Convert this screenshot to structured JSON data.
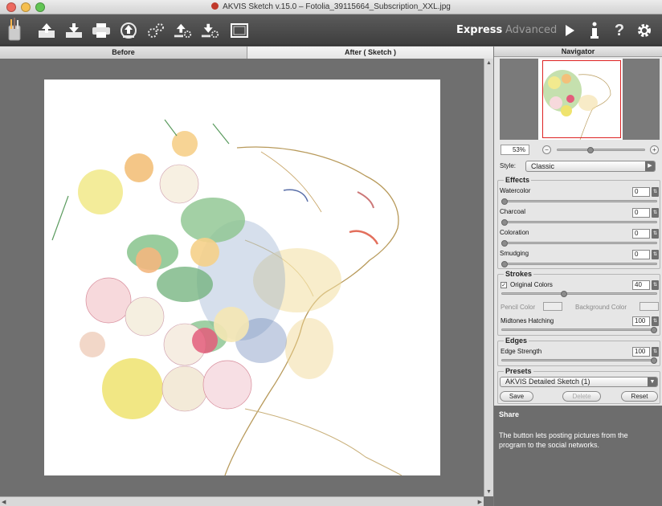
{
  "window": {
    "title": "AKVIS Sketch v.15.0 – Fotolia_39115664_Subscription_XXL.jpg",
    "traffic_lights": [
      "#ed6a5f",
      "#f5bf4f",
      "#62c554"
    ]
  },
  "toolbar": {
    "icons": [
      "sketch-tool-icon",
      "open-icon",
      "save-icon",
      "print-icon",
      "import-preset-icon",
      "batch-icon",
      "preferences-icon",
      "export-preset-icon",
      "crop-icon"
    ],
    "express_label": "Express",
    "advanced_label": "Advanced",
    "run_icon": "play-icon",
    "info_icon": "info-icon",
    "help_icon": "help-icon",
    "settings_icon": "gear-icon",
    "express_color": "#ffffff",
    "advanced_color": "#9c9c9c"
  },
  "tabs": {
    "before": "Before",
    "after": "After ( Sketch )"
  },
  "navigator": {
    "title": "Navigator",
    "zoom": "53%"
  },
  "style": {
    "label": "Style:",
    "value": "Classic"
  },
  "effects": {
    "title": "Effects",
    "items": [
      {
        "label": "Watercolor",
        "value": "0",
        "level": 0
      },
      {
        "label": "Charcoal",
        "value": "0",
        "level": 0
      },
      {
        "label": "Coloration",
        "value": "0",
        "level": 0
      },
      {
        "label": "Smudging",
        "value": "0",
        "level": 0
      }
    ]
  },
  "strokes": {
    "title": "Strokes",
    "original_colors_label": "Original Colors",
    "original_colors_checked": true,
    "stroke_value": "40",
    "stroke_level": 0.4,
    "pencil_color_label": "Pencil Color",
    "background_color_label": "Background Color",
    "midtones_label": "Midtones Hatching",
    "midtones_value": "100",
    "midtones_level": 1
  },
  "edges": {
    "title": "Edges",
    "edge_strength_label": "Edge Strength",
    "edge_strength_value": "100",
    "edge_strength_level": 1
  },
  "presets": {
    "title": "Presets",
    "selected": "AKVIS Detailed Sketch (1)",
    "save_label": "Save",
    "delete_label": "Delete",
    "reset_label": "Reset"
  },
  "share": {
    "title": "Share",
    "text": "The button lets posting pictures from the program to the social networks."
  }
}
